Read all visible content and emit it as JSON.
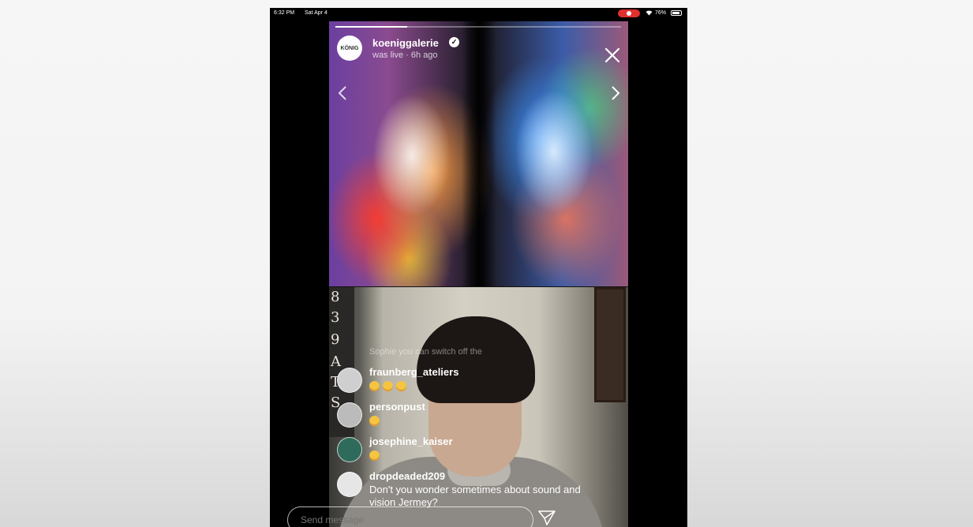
{
  "status_bar": {
    "time": "6:32 PM",
    "date": "Sat Apr 4",
    "battery": "76%",
    "recording_color": "#e0302e"
  },
  "story": {
    "progress": 0.25,
    "username": "koeniggalerie",
    "avatar_logo": "KÖNIG",
    "status": "was live · 6h ago",
    "verified_icon": "verified-badge-icon",
    "close_icon": "close-icon"
  },
  "poster_letters": [
    "8",
    "3",
    "9",
    "A",
    "T",
    "S"
  ],
  "comments": {
    "faded": "Sophie you can switch off the",
    "items": [
      {
        "user": "fraunberg_ateliers",
        "text": "",
        "emoji_count": 3,
        "avatar_color": "#cfcfcf"
      },
      {
        "user": "personpust",
        "text": "",
        "emoji_count": 1,
        "avatar_color": "#bbbbbb"
      },
      {
        "user": "josephine_kaiser",
        "text": "",
        "emoji_count": 1,
        "avatar_color": "#2f6b5a"
      },
      {
        "user": "dropdeaded209",
        "text": "Don't you wonder sometimes about sound and vision Jermey?",
        "emoji_count": 0,
        "avatar_color": "#e6e6e6"
      }
    ]
  },
  "message_bar": {
    "placeholder": "Send message",
    "send_icon": "send-icon"
  }
}
